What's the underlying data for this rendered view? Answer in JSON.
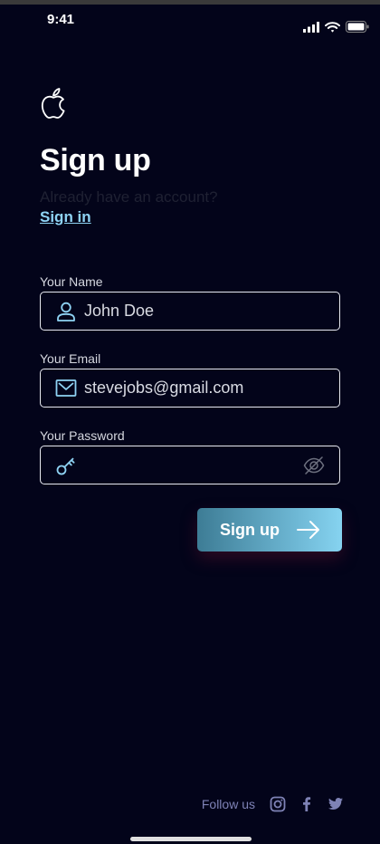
{
  "status": {
    "time": "9:41"
  },
  "header": {
    "title": "Sign up",
    "subtitle": "Already have an account?",
    "signin_link": "Sign in"
  },
  "form": {
    "name": {
      "label": "Your Name",
      "value": "John Doe",
      "icon": "user-icon"
    },
    "email": {
      "label": "Your Email",
      "value": "stevejobs@gmail.com",
      "icon": "mail-icon"
    },
    "password": {
      "label": "Your Password",
      "value": "",
      "icon": "key-icon",
      "toggle_icon": "eye-off-icon"
    }
  },
  "submit": {
    "label": "Sign up",
    "icon": "arrow-right-icon"
  },
  "footer": {
    "follow_text": "Follow us",
    "socials": [
      "instagram-icon",
      "facebook-icon",
      "twitter-icon"
    ]
  },
  "colors": {
    "background": "#03041a",
    "accent": "#8fd3f4",
    "button_start": "#3d7c95",
    "button_end": "#86d3f0"
  }
}
